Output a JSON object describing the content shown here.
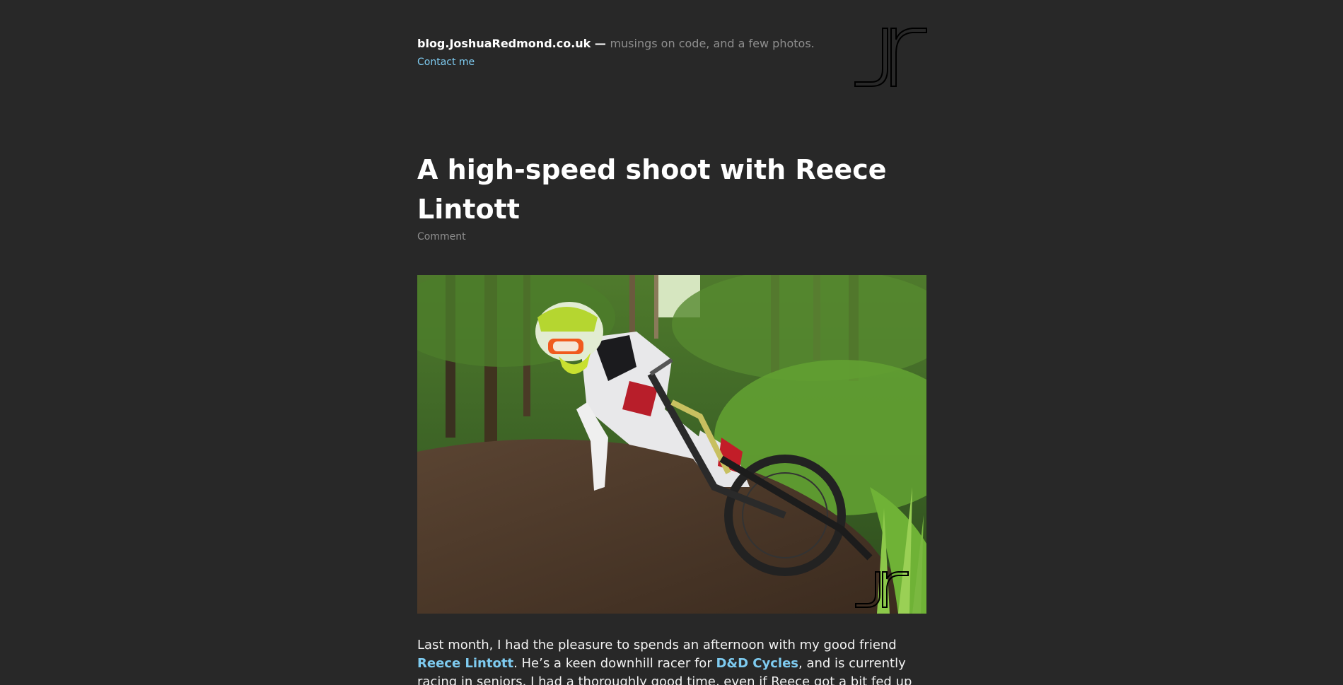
{
  "header": {
    "site_name": "blog.JoshuaRedmond.co.uk",
    "dash": " — ",
    "tagline": "musings on code, and a few photos.",
    "contact_label": "Contact me",
    "logo_icon": "jr-monogram-icon"
  },
  "post": {
    "title": "A high-speed shoot with Reece Lintott",
    "comment_label": "Comment",
    "photo_icon": "downhill-rider-photo",
    "paragraph": {
      "part1": "Last month, I had the pleasure to spends an afternoon with my good friend ",
      "link1": "Reece Lintott",
      "part2": ". He’s a keen downhill racer for ",
      "link2": "D&D Cycles",
      "part3": ", and is currently racing in seniors. I had a thoroughly good time, even if Reece got a bit fed up of hearing “that"
    }
  },
  "colors": {
    "background": "#282828",
    "link": "#7ecbf0",
    "muted": "#8e8e8e",
    "text": "#ffffff"
  }
}
